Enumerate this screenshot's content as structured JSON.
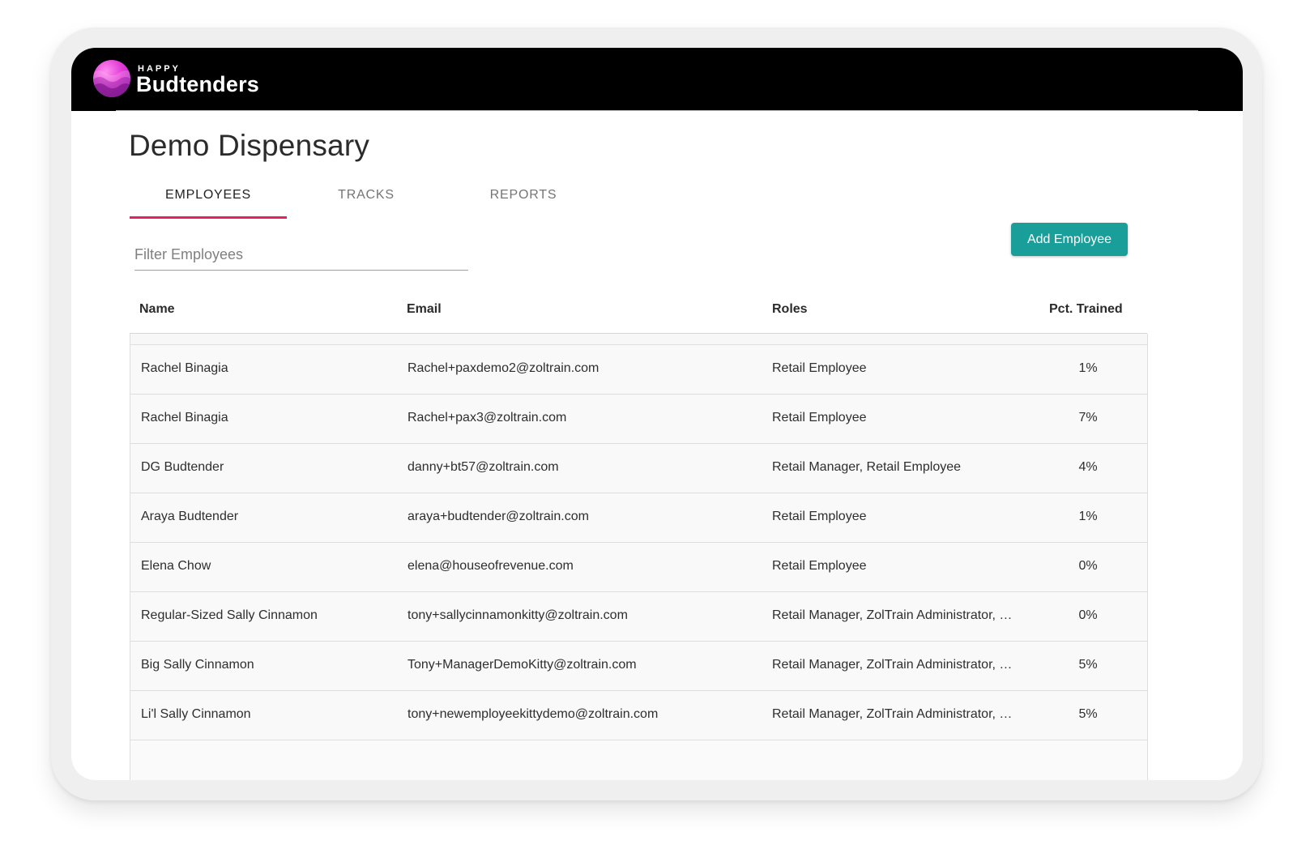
{
  "brand": {
    "small_text": "HAPPY",
    "name": "Budtenders",
    "logo_colors": [
      "#ff8df0",
      "#e23ad6",
      "#9b1fb3"
    ]
  },
  "page": {
    "title": "Demo Dispensary"
  },
  "tabs": [
    {
      "label": "EMPLOYEES",
      "active": true
    },
    {
      "label": "TRACKS",
      "active": false
    },
    {
      "label": "REPORTS",
      "active": false
    }
  ],
  "filter": {
    "placeholder": "Filter Employees",
    "value": ""
  },
  "actions": {
    "add_employee_label": "Add Employee",
    "accent_color": "#1a9e9a"
  },
  "tab_accent_color": "#e91e63",
  "table": {
    "columns": [
      "Name",
      "Email",
      "Roles",
      "Pct. Trained"
    ],
    "rows": [
      {
        "name": "Rachel Binagia",
        "email": "Rachel+paxdemo2@zoltrain.com",
        "roles": "Retail Employee",
        "pct": "1%"
      },
      {
        "name": "Rachel Binagia",
        "email": "Rachel+pax3@zoltrain.com",
        "roles": "Retail Employee",
        "pct": "7%"
      },
      {
        "name": "DG Budtender",
        "email": "danny+bt57@zoltrain.com",
        "roles": "Retail Manager, Retail Employee",
        "pct": "4%"
      },
      {
        "name": "Araya Budtender",
        "email": "araya+budtender@zoltrain.com",
        "roles": "Retail Employee",
        "pct": "1%"
      },
      {
        "name": "Elena Chow",
        "email": "elena@houseofrevenue.com",
        "roles": "Retail Employee",
        "pct": "0%"
      },
      {
        "name": "Regular-Sized Sally Cinnamon",
        "email": "tony+sallycinnamonkitty@zoltrain.com",
        "roles": "Retail Manager, ZolTrain Administrator, …",
        "pct": "0%"
      },
      {
        "name": "Big Sally Cinnamon",
        "email": "Tony+ManagerDemoKitty@zoltrain.com",
        "roles": "Retail Manager, ZolTrain Administrator, …",
        "pct": "5%"
      },
      {
        "name": "Li'l Sally Cinnamon",
        "email": "tony+newemployeekittydemo@zoltrain.com",
        "roles": "Retail Manager, ZolTrain Administrator, …",
        "pct": "5%"
      }
    ]
  }
}
